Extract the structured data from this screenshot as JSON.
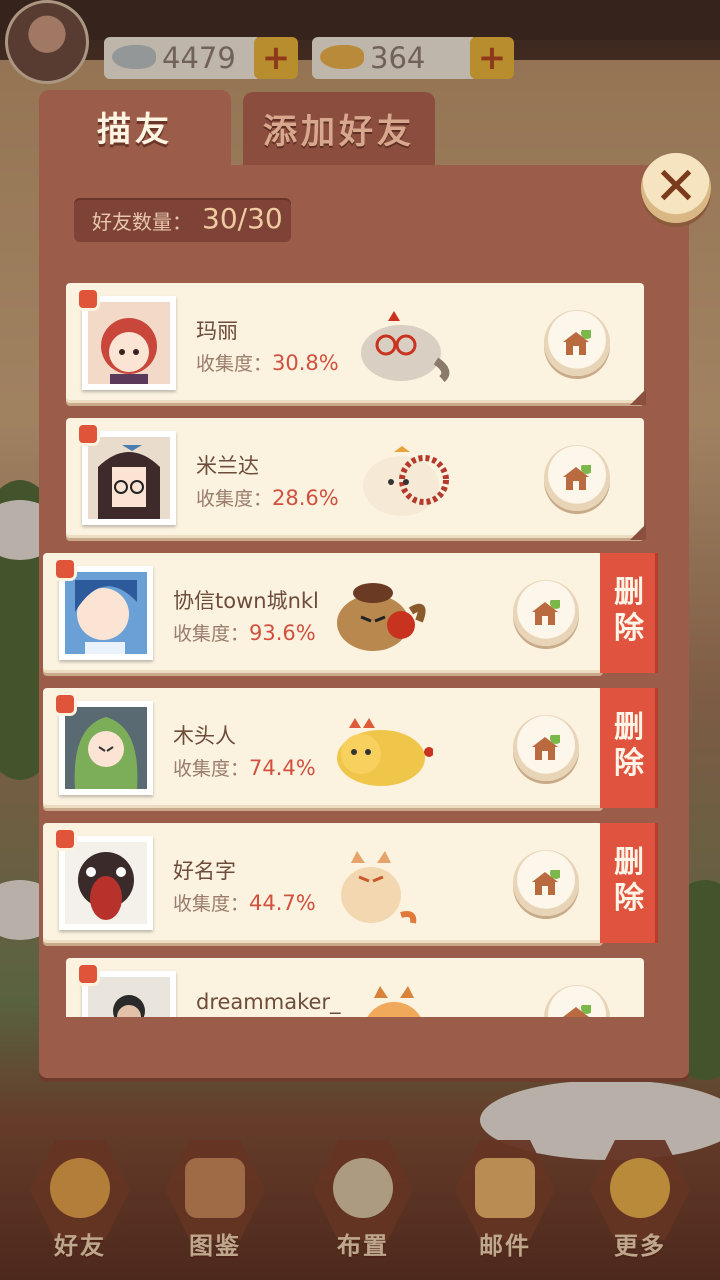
{
  "currency": {
    "fish_blue": "4479",
    "fish_gold": "364",
    "plus": "+"
  },
  "tabs": {
    "friends": "描友",
    "add_friend": "添加好友"
  },
  "close": "✕",
  "friend_count": {
    "label": "好友数量：",
    "value": "30/30"
  },
  "collection_label": "收集度：",
  "delete_label_line1": "删",
  "delete_label_line2": "除",
  "friends": [
    {
      "name": "玛丽",
      "collection": "30.8%",
      "photo_color": "#c8473a",
      "cat_color": "#d9cfc2",
      "deletable": false
    },
    {
      "name": "米兰达",
      "collection": "28.6%",
      "photo_color": "#3e2a2a",
      "cat_color": "#f6ead6",
      "deletable": false
    },
    {
      "name": "协信town城nkl",
      "collection": "93.6%",
      "photo_color": "#6aa0d6",
      "cat_color": "#b8884e",
      "deletable": true
    },
    {
      "name": "木头人",
      "collection": "74.4%",
      "photo_color": "#7cae5a",
      "cat_color": "#f0c64a",
      "deletable": true
    },
    {
      "name": "好名字",
      "collection": "44.7%",
      "photo_color": "#b7322a",
      "cat_color": "#f3d7b0",
      "deletable": true
    },
    {
      "name": "dreammaker_",
      "collection": "",
      "photo_color": "#e9e4dc",
      "cat_color": "#f0a85a",
      "deletable": false
    }
  ],
  "bottom_nav": [
    {
      "label": "好友",
      "color": "#e2a24a"
    },
    {
      "label": "图鉴",
      "color": "#c7875a"
    },
    {
      "label": "布置",
      "color": "#d9c9a8"
    },
    {
      "label": "邮件",
      "color": "#e9b46a"
    },
    {
      "label": "更多",
      "color": "#e9b24a"
    }
  ],
  "colors": {
    "panel": "#9c5c4a",
    "card": "#fbf2e0",
    "accent_red": "#e0533e",
    "percent": "#d2503e"
  }
}
